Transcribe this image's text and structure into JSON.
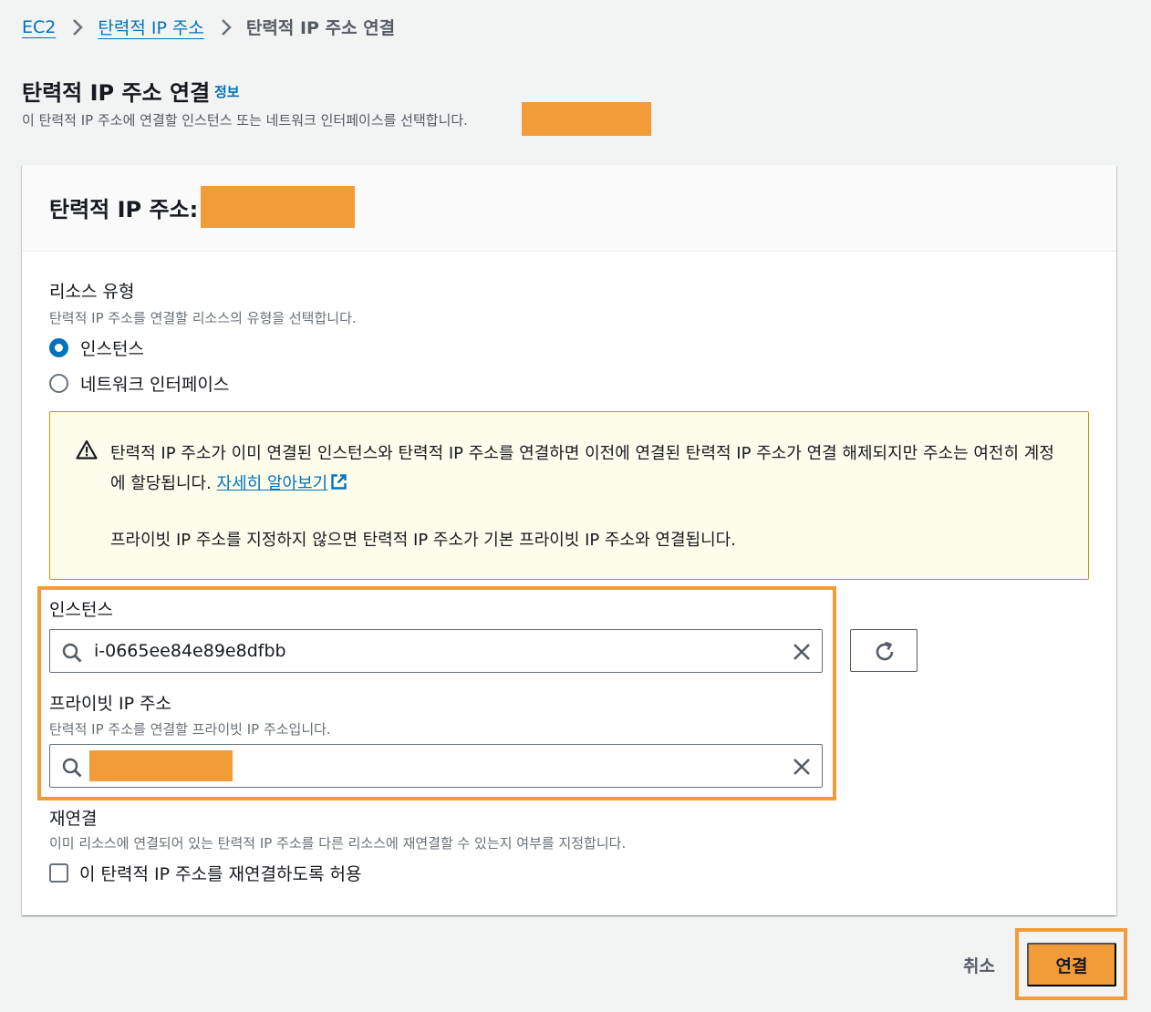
{
  "breadcrumb": {
    "items": [
      {
        "label": "EC2"
      },
      {
        "label": "탄력적 IP 주소"
      },
      {
        "label": "탄력적 IP 주소 연결"
      }
    ]
  },
  "page": {
    "title": "탄력적 IP 주소 연결",
    "info_link": "정보",
    "description": "이 탄력적 IP 주소에 연결할 인스턴스 또는 네트워크 인터페이스를 선택합니다."
  },
  "panel": {
    "title": "탄력적 IP 주소:"
  },
  "resource_type": {
    "label": "리소스 유형",
    "description": "탄력적 IP 주소를 연결할 리소스의 유형을 선택합니다.",
    "options": [
      {
        "label": "인스턴스",
        "selected": true
      },
      {
        "label": "네트워크 인터페이스",
        "selected": false
      }
    ]
  },
  "alert": {
    "text": "탄력적 IP 주소가 이미 연결된 인스턴스와 탄력적 IP 주소를 연결하면 이전에 연결된 탄력적 IP 주소가 연결 해제되지만 주소는 여전히 계정에 할당됩니다.",
    "link": "자세히 알아보기",
    "text2": "프라이빗 IP 주소를 지정하지 않으면 탄력적 IP 주소가 기본 프라이빗 IP 주소와 연결됩니다."
  },
  "instance": {
    "label": "인스턴스",
    "value": "i-0665ee84e89e8dfbb"
  },
  "private_ip": {
    "label": "프라이빗 IP 주소",
    "description": "탄력적 IP 주소를 연결할 프라이빗 IP 주소입니다.",
    "value": ""
  },
  "reassociate": {
    "label": "재연결",
    "description": "이미 리소스에 연결되어 있는 탄력적 IP 주소를 다른 리소스에 재연결할 수 있는지 여부를 지정합니다.",
    "checkbox_label": "이 탄력적 IP 주소를 재연결하도록 허용",
    "checked": false
  },
  "actions": {
    "cancel": "취소",
    "connect": "연결"
  },
  "colors": {
    "link": "#0073bb",
    "primary": "#f19c38",
    "alert_bg": "#fefdec",
    "background": "#f2f3f3"
  },
  "icons": [
    "chevron-right-icon",
    "warning-icon",
    "external-link-icon",
    "search-icon",
    "clear-icon",
    "refresh-icon"
  ]
}
